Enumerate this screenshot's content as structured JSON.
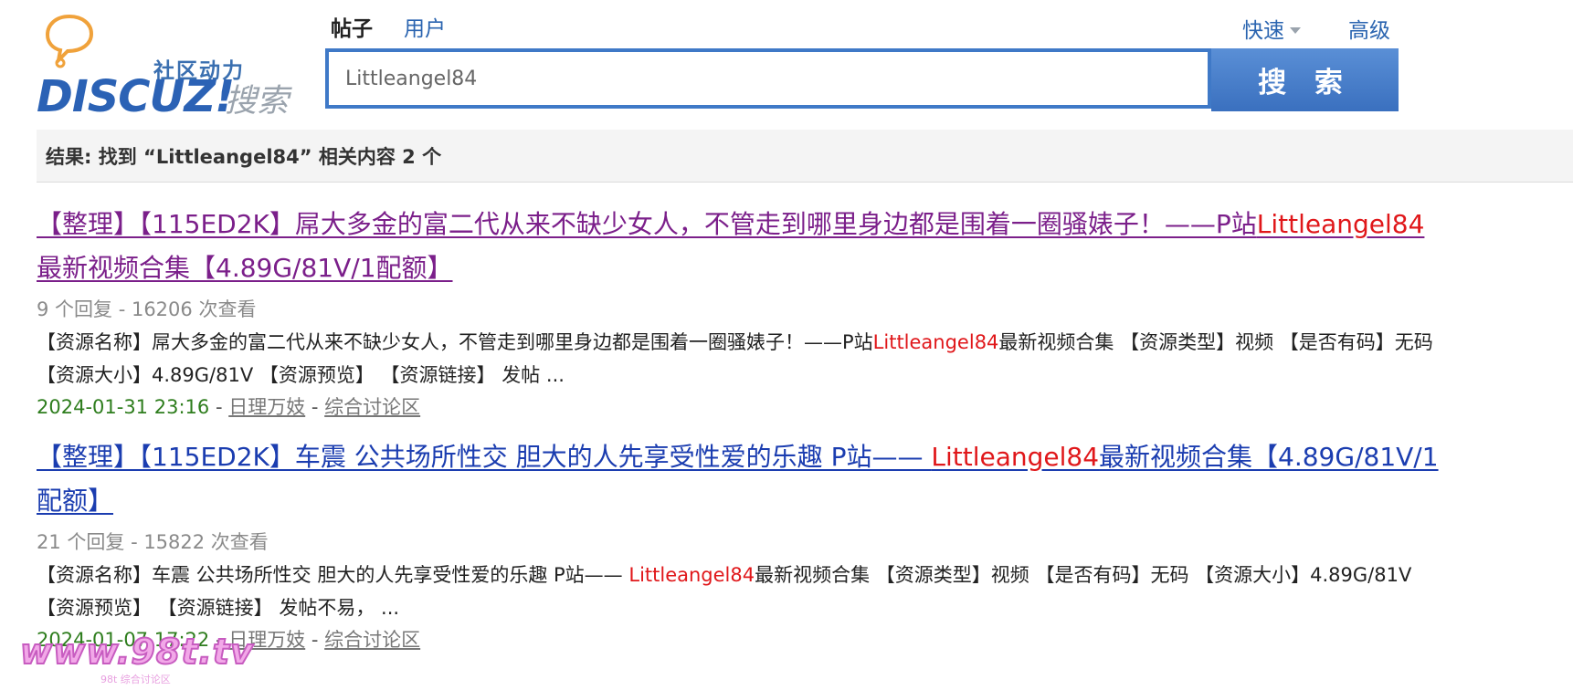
{
  "logo": {
    "community_text": "社区动力",
    "brand_text": "DISCUZ!",
    "search_text": "搜索"
  },
  "tabs": {
    "posts": "帖子",
    "users": "用户"
  },
  "quick_mode": "快速",
  "advanced": "高级",
  "search": {
    "value": "Littleangel84",
    "button": "搜 索"
  },
  "result_bar": "结果: 找到 “Littleangel84” 相关内容 2 个",
  "results": [
    {
      "title_pre": "【整理】【115ED2K】屌大多金的富二代从来不缺少女人，不管走到哪里身边都是围着一圈骚婊子！——P站",
      "title_hl": "Littleangel84",
      "title_post": "最新视频合集【4.89G/81V/1配额】",
      "stats": "9 个回复 - 16206 次查看",
      "summary_pre": "【资源名称】屌大多金的富二代从来不缺少女人，不管走到哪里身边都是围着一圈骚婊子！——P站",
      "summary_hl": "Littleangel84",
      "summary_post": "最新视频合集 【资源类型】视频 【是否有码】无码 【资源大小】4.89G/81V 【资源预览】 【资源链接】 发帖 ...",
      "date": "2024-01-31 23:16",
      "author": "日理万妓",
      "forum": "综合讨论区"
    },
    {
      "title_pre": "【整理】【115ED2K】车震 公共场所性交 胆大的人先享受性爱的乐趣 P站—— ",
      "title_hl": "Littleangel84",
      "title_post": "最新视频合集【4.89G/81V/1配额】",
      "stats": "21 个回复 - 15822 次查看",
      "summary_pre": "【资源名称】车震 公共场所性交 胆大的人先享受性爱的乐趣 P站—— ",
      "summary_hl": "Littleangel84",
      "summary_post": "最新视频合集 【资源类型】视频 【是否有码】无码 【资源大小】4.89G/81V 【资源预览】 【资源链接】 发帖不易， ...",
      "date": "2024-01-07 17:22",
      "author": "日理万妓",
      "forum": "综合讨论区"
    }
  ],
  "watermark": {
    "text": "www.98t.tv",
    "sub": "98t 综合讨论区"
  },
  "colors": {
    "accent": "#3f79c7",
    "highlight": "#e0171a",
    "visited_link": "#7b1f8a",
    "link": "#1b3db0",
    "date": "#2e7d1d"
  }
}
